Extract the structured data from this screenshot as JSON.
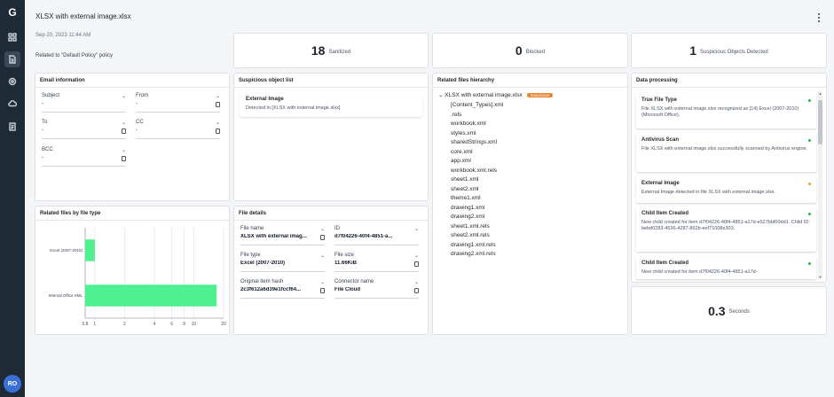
{
  "nav": {
    "logo": "G",
    "items": [
      "dashboard",
      "document",
      "policy",
      "cloud",
      "report"
    ],
    "active_index": 1,
    "avatar": "RO"
  },
  "header": {
    "title": "XLSX with external image.xlsx",
    "date": "Sep 20, 2023 11:44 AM",
    "policy": "Related to \"Default Policy\" policy"
  },
  "stats": [
    {
      "value": "18",
      "label": "Sanitized"
    },
    {
      "value": "0",
      "label": "Blocked"
    },
    {
      "value": "1",
      "label": "Suspicious Objects Detected"
    }
  ],
  "email_info": {
    "title": "Email information",
    "fields": [
      {
        "label": "Subject",
        "value": "-"
      },
      {
        "label": "From",
        "value": "-"
      },
      {
        "label": "To",
        "value": "-"
      },
      {
        "label": "CC",
        "value": "-"
      },
      {
        "label": "BCC",
        "value": "-"
      }
    ]
  },
  "suspicious": {
    "title": "Suspicious object list",
    "items": [
      {
        "name": "External Image",
        "detail": "Detected in [XLSX with external image.xlsx]"
      }
    ]
  },
  "hierarchy": {
    "title": "Related files hierarchy",
    "root": "XLSX with external image.xlsx",
    "root_badge": "Suspicious",
    "children": [
      "[Content_Types].xml",
      ".rels",
      "workbook.xml",
      "styles.xml",
      "sharedStrings.xml",
      "core.xml",
      "app.xml",
      "workbook.xml.rels",
      "sheet1.xml",
      "sheet2.xml",
      "theme1.xml",
      "drawing1.xml",
      "drawing2.xml",
      "sheet1.xml.rels",
      "sheet2.xml.rels",
      "drawing1.xml.rels",
      "drawing2.xml.rels"
    ]
  },
  "processing": {
    "title": "Data processing",
    "items": [
      {
        "title": "True File Type",
        "detail": "File XLSX with external image.xlsx recognized as [14] Excel (2007-2010) (Microsoft Office).",
        "status_color": "#2fb344"
      },
      {
        "title": "Antivirus Scan",
        "detail": "File XLSX with external image.xlsx successfully scanned by Antivirus engine.",
        "status_color": "#2fb344"
      },
      {
        "title": "External Image",
        "detail": "External Image detected in file XLSX with external image.xlsx.",
        "status_color": "#f0a020"
      },
      {
        "title": "Child Item Created",
        "detail": "New child created for item d7f04226-40f4-4851-a17d-e527bbf00dd1. Child ID: bebd0283-4636-4287-862b-eef71008e303.",
        "status_color": "#2fb344"
      },
      {
        "title": "Child Item Created",
        "detail": "New child created for item d7f04226-40f4-4851-a17d-",
        "status_color": "#2fb344"
      }
    ]
  },
  "seconds": {
    "value": "0.3",
    "label": "Seconds"
  },
  "file_details": {
    "title": "File details",
    "fields": [
      {
        "label": "File name",
        "value": "XLSX with external imag..."
      },
      {
        "label": "ID",
        "value": "d7f04226-40f4-4851-a..."
      },
      {
        "label": "File type",
        "value": "Excel (2007-2010)"
      },
      {
        "label": "File size",
        "value": "11.66KiB"
      },
      {
        "label": "Original item hash",
        "value": "2c3f612a6d39e1fccf64..."
      },
      {
        "label": "Connector name",
        "value": "File Cloud"
      }
    ]
  },
  "chart_title": "Related files by file type",
  "chart_data": {
    "type": "bar",
    "orientation": "horizontal",
    "x_scale": "log",
    "categories": [
      "Excel (2007-2010)",
      "Internal Office XML"
    ],
    "values": [
      1,
      17
    ],
    "xlim": [
      0.8,
      20
    ],
    "xticks": [
      "0.8",
      "1",
      "2",
      "4",
      "6",
      "8",
      "10",
      "20"
    ],
    "grid": true,
    "color": "#4ef08f"
  }
}
